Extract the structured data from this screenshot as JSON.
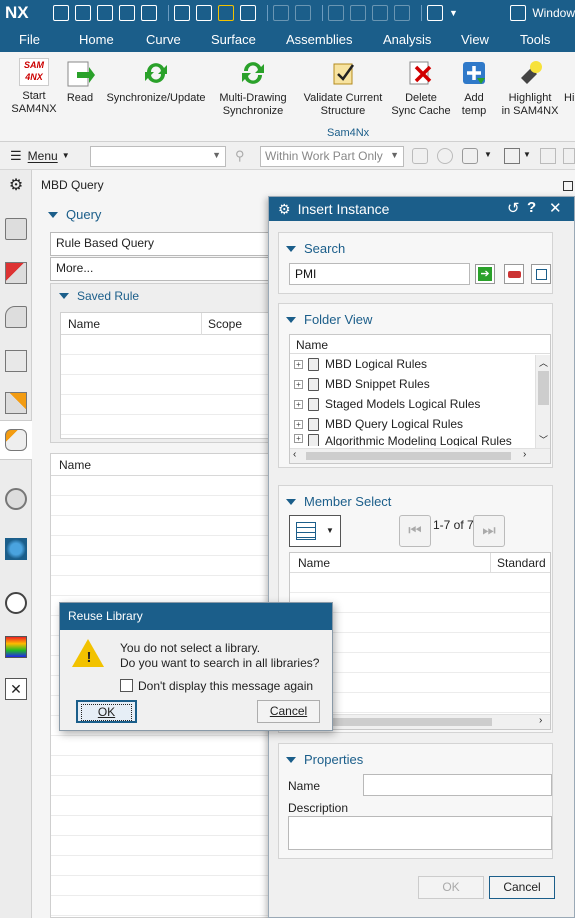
{
  "titlebar": {
    "logo": "NX",
    "window_menu": "Window"
  },
  "tabs": [
    "File",
    "Home",
    "Curve",
    "Surface",
    "Assemblies",
    "Analysis",
    "View",
    "Tools"
  ],
  "ribbon": {
    "sam_badge": "SAM\n4NX",
    "buttons": [
      {
        "label1": "Start",
        "label2": "SAM4NX"
      },
      {
        "label1": "Read",
        "label2": ""
      },
      {
        "label1": "Synchronize/Update",
        "label2": ""
      },
      {
        "label1": "Multi-Drawing",
        "label2": "Synchronize"
      },
      {
        "label1": "Validate Current",
        "label2": "Structure"
      },
      {
        "label1": "Delete",
        "label2": "Sync Cache"
      },
      {
        "label1": "Add",
        "label2": "temp"
      },
      {
        "label1": "Highlight",
        "label2": "in SAM4NX"
      },
      {
        "label1": "Hi",
        "label2": ""
      }
    ],
    "group_label": "Sam4Nx"
  },
  "cmdbar": {
    "menu_label": "Menu",
    "filter_value": "",
    "scope_value": "Within Work Part Only"
  },
  "mbd_query": {
    "title": "MBD Query",
    "query_section": "Query",
    "query_type": "Rule Based Query",
    "more_label": "More...",
    "saved_rule_section": "Saved Rule",
    "saved_rule_columns": [
      "Name",
      "Scope"
    ],
    "results_column": "Name"
  },
  "insert_instance": {
    "title": "Insert Instance",
    "search_section": "Search",
    "search_value": "PMI",
    "folder_section": "Folder View",
    "folder_column": "Name",
    "folders": [
      "MBD Logical Rules",
      "MBD Snippet Rules",
      "Staged Models Logical Rules",
      "MBD Query Logical Rules",
      "Algorithmic Modeling Logical Rules"
    ],
    "member_section": "Member Select",
    "pager_text": "1-7 of 7",
    "member_columns": [
      "Name",
      "Standard"
    ],
    "properties_section": "Properties",
    "name_label": "Name",
    "description_label": "Description",
    "ok_label": "OK",
    "cancel_label": "Cancel"
  },
  "reuse_library": {
    "title": "Reuse Library",
    "message_line1": "You do not select a library.",
    "message_line2": "Do you want to search in all libraries?",
    "checkbox_label": "Don't display this message again",
    "ok_label": "OK",
    "cancel_label": "Cancel"
  }
}
